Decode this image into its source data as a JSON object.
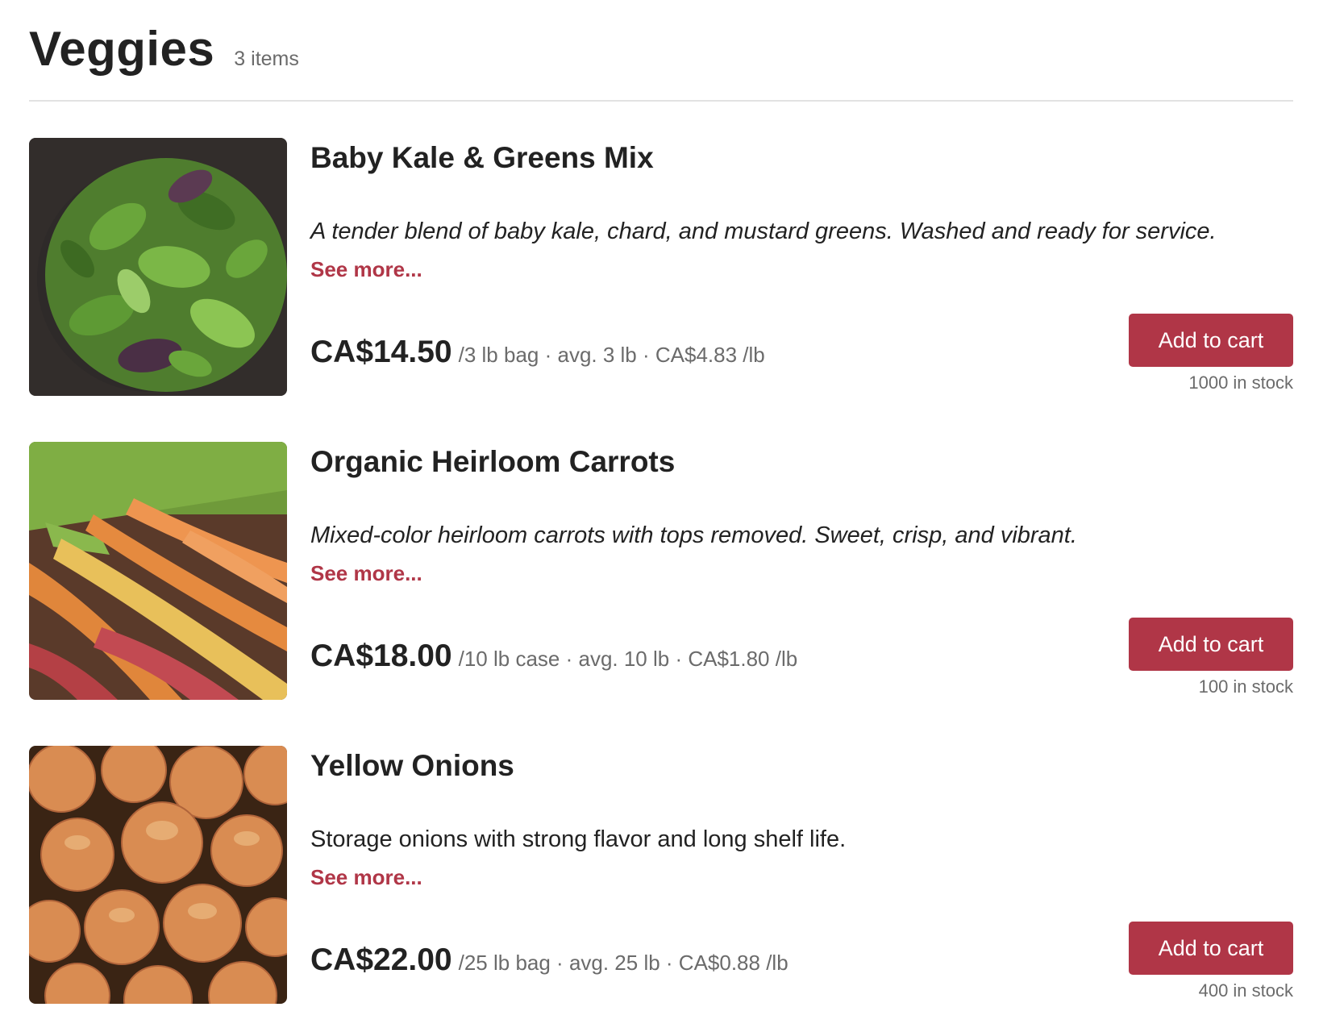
{
  "header": {
    "title": "Veggies",
    "count": "3 items"
  },
  "products": [
    {
      "name": "Baby Kale & Greens Mix",
      "description": "A tender blend of baby kale, chard, and mustard greens. Washed and ready for service.",
      "see_more": "See more...",
      "price": "CA$14.50",
      "unit_info": "/3 lb bag · avg. 3 lb · CA$4.83 /lb",
      "button": "Add to cart",
      "stock": "1000 in stock",
      "image_icon": "salad-greens-photo"
    },
    {
      "name": "Organic Heirloom Carrots",
      "description": "Mixed-color heirloom carrots with tops removed. Sweet, crisp, and vibrant.",
      "see_more": "See more...",
      "price": "CA$18.00",
      "unit_info": "/10 lb case · avg. 10 lb · CA$1.80 /lb",
      "button": "Add to cart",
      "stock": "100 in stock",
      "image_icon": "carrots-photo"
    },
    {
      "name": "Yellow Onions",
      "description": "Storage onions with strong flavor and long shelf life.",
      "see_more": "See more...",
      "price": "CA$22.00",
      "unit_info": "/25 lb bag · avg. 25 lb · CA$0.88 /lb",
      "button": "Add to cart",
      "stock": "400 in stock",
      "image_icon": "onions-photo"
    }
  ],
  "colors": {
    "accent": "#b03647",
    "text": "#222222",
    "muted": "#6b6b6b",
    "divider": "#e2e2e2"
  }
}
